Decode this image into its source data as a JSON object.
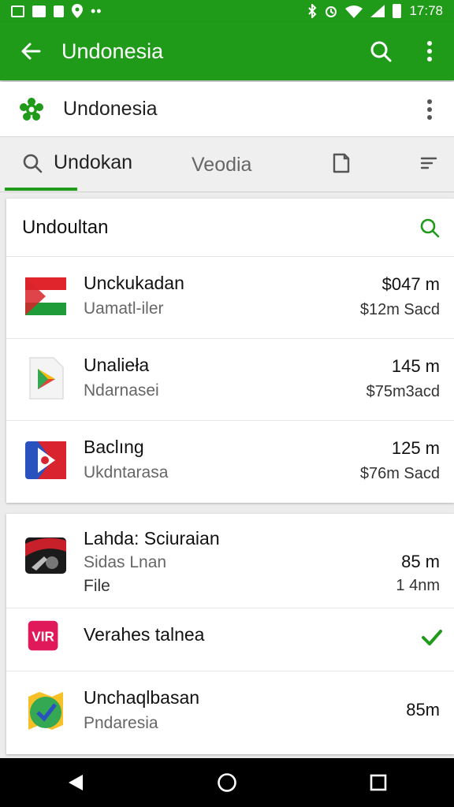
{
  "status_bar": {
    "time": "17:78",
    "left_icons": [
      "image-icon",
      "mail-icon",
      "bookmark-icon",
      "location-icon",
      "more-dots-icon"
    ],
    "right_icons": [
      "bluetooth-icon",
      "alarm-icon",
      "wifi-icon",
      "signal-icon",
      "battery-icon"
    ]
  },
  "app_bar": {
    "title": "Undonesia",
    "icons": [
      "back-arrow-icon",
      "search-icon",
      "overflow-menu-icon"
    ]
  },
  "sub_header": {
    "title": "Undonesia"
  },
  "tabs": {
    "items": [
      {
        "label": "Undokan",
        "icon": "search-icon",
        "selected": true
      },
      {
        "label": "Veodia",
        "selected": false
      },
      {
        "label": "",
        "icon": "document-icon",
        "selected": false
      },
      {
        "label": "",
        "icon": "sort-icon",
        "selected": false
      }
    ]
  },
  "card1": {
    "title": "Undoultan",
    "items": [
      {
        "name": "Unckukadan",
        "subtitle": "Uamatl-iler",
        "size": "$047 m",
        "detail": "$12m Sacd"
      },
      {
        "name": "Unalieła",
        "subtitle": "Ndarnasei",
        "size": "145 m",
        "detail": "$75m3acd"
      },
      {
        "name": "Baclıng",
        "subtitle": "Ukdntarasa",
        "size": "125 m",
        "detail": "$76m Sacd"
      }
    ]
  },
  "card2": {
    "items": [
      {
        "name": "Lahda: Sciuraian",
        "subtitle": "Sidas Lnan",
        "line3": "File",
        "size": "85 m",
        "detail": "1 4nm"
      },
      {
        "name": "Verahes talnea"
      },
      {
        "name": "Unchaqlbasan",
        "subtitle": "Pndaresia",
        "size": "85m"
      }
    ]
  },
  "colors": {
    "brand_green": "#1f9b19",
    "background": "#ececec",
    "nav_bar": "#000000"
  }
}
